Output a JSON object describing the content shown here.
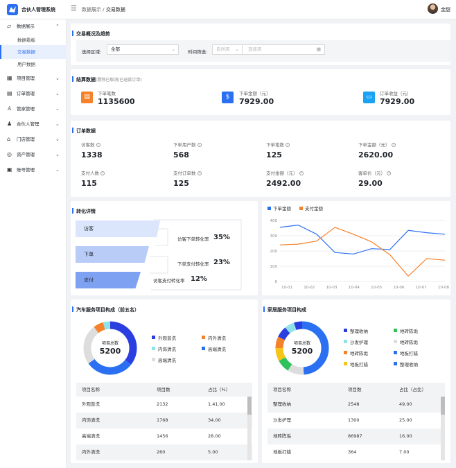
{
  "app": {
    "title": "合伙人管理系统",
    "user": "金甜"
  },
  "breadcrumb": {
    "parent": "数据展示",
    "sep": "/",
    "current": "交易数据"
  },
  "sidebar": {
    "items": [
      {
        "label": "数据展示",
        "icon": "chart-icon",
        "arrow": "^"
      },
      {
        "label": "数据看板"
      },
      {
        "label": "交易数据"
      },
      {
        "label": "用户数据"
      },
      {
        "label": "项目管理",
        "icon": "grid-icon",
        "arrow": "v"
      },
      {
        "label": "订单管理",
        "icon": "clipboard-icon",
        "arrow": "v"
      },
      {
        "label": "管家管理",
        "icon": "person-icon",
        "arrow": "v"
      },
      {
        "label": "合伙人管理",
        "icon": "people-icon",
        "arrow": "v"
      },
      {
        "label": "门店管理",
        "icon": "store-icon",
        "arrow": "v"
      },
      {
        "label": "资产管理",
        "icon": "coin-icon",
        "arrow": "v"
      },
      {
        "label": "账号管理",
        "icon": "account-icon",
        "arrow": "v"
      }
    ]
  },
  "overview": {
    "title": "交易概况及趋势",
    "region_label": "选择区域:",
    "region_value": "全部",
    "time_label": "时间筛选:",
    "time_unit": "自然周",
    "date_placeholder": "选择周"
  },
  "settlement": {
    "title": "结算数据",
    "note": "(剔除已取消/已退款订单)",
    "stats": [
      {
        "label": "下单笔数",
        "value": "1135600",
        "color": "#f5822a"
      },
      {
        "label": "下单金额（元）",
        "value": "7929.00",
        "color": "#2b6ff2"
      },
      {
        "label": "订单收益（元）",
        "value": "7929.00",
        "color": "#1aa3f5"
      }
    ]
  },
  "orders": {
    "title": "订单数据",
    "stats": [
      {
        "label": "访客数",
        "value": "1338"
      },
      {
        "label": "下单用户数",
        "value": "568"
      },
      {
        "label": "下单笔数",
        "value": "125"
      },
      {
        "label": "下单金额（元）",
        "value": "2620.00"
      },
      {
        "label": "支付人数",
        "value": "115"
      },
      {
        "label": "支付订单数",
        "value": "125"
      },
      {
        "label": "支付金额（元）",
        "value": "2492.00"
      },
      {
        "label": "客单价（元）",
        "value": "29.00"
      }
    ]
  },
  "conversion": {
    "title": "转化详情",
    "steps": [
      "访客",
      "下单",
      "支付"
    ],
    "rates": [
      {
        "label": "访客下单转化率",
        "value": "35%"
      },
      {
        "label": "下单支付转化率",
        "value": "23%"
      },
      {
        "label": "访客支付转化率",
        "value": "12%"
      }
    ]
  },
  "chart_data": {
    "type": "line",
    "x": [
      "10-01",
      "10-02",
      "10-03",
      "10-04",
      "10-05",
      "10-06",
      "10-07",
      "10-08"
    ],
    "ylim": [
      0,
      400
    ],
    "yticks": [
      0,
      100,
      200,
      300,
      400
    ],
    "legend_position": "top-left",
    "series": [
      {
        "name": "下单金额",
        "color": "#2b6ff2",
        "values": [
          355,
          370,
          310,
          190,
          180,
          215,
          210,
          335,
          320,
          310
        ]
      },
      {
        "name": "支付金额",
        "color": "#f5822a",
        "values": [
          240,
          245,
          265,
          355,
          310,
          260,
          175,
          35,
          150,
          140
        ]
      }
    ],
    "x_positions_note": ""
  },
  "car_service": {
    "title": "汽车服务项目构成（前五名）",
    "center_label": "项目总数",
    "center_value": "5200",
    "legend": [
      {
        "name": "外观普洗",
        "color": "#2b3fe0"
      },
      {
        "name": "内外清洗",
        "color": "#f5822a"
      },
      {
        "name": "内饰清洗",
        "color": "#8fe3e8"
      },
      {
        "name": "高端清洗",
        "color": "#2b6ff2"
      },
      {
        "name": "高端清洗",
        "color": "#dddddd"
      }
    ],
    "slices": [
      41,
      34,
      28,
      7,
      5
    ],
    "slice_colors": [
      "#2b3fe0",
      "#2b6ff2",
      "#dddddd",
      "#f5822a",
      "#8fe3e8"
    ],
    "headers": [
      "项目名称",
      "项目数",
      "占比（%）"
    ],
    "rows": [
      [
        "外观普洗",
        "2132",
        "1.41.00"
      ],
      [
        "内饰清洗",
        "1768",
        "34.00"
      ],
      [
        "高端清洗",
        "1456",
        "28.00"
      ],
      [
        "内外清洗",
        "260",
        "5.00"
      ]
    ]
  },
  "home_service": {
    "title": "家居服务项目构成",
    "center_label": "项目总数",
    "center_value": "5200",
    "legend": [
      {
        "name": "整理收纳",
        "color": "#2b3fe0"
      },
      {
        "name": "地砖陈垢",
        "color": "#2fc25b"
      },
      {
        "name": "沙发护理",
        "color": "#8fe3e8"
      },
      {
        "name": "地砖陈垢",
        "color": "#dddddd"
      },
      {
        "name": "地砖陈垢",
        "color": "#f5822a"
      },
      {
        "name": "地板打蜡",
        "color": "#2b6ff2"
      },
      {
        "name": "地板打蜡",
        "color": "#f5c518"
      },
      {
        "name": "整理收纳",
        "color": "#2b6ff2"
      }
    ],
    "slices": [
      49,
      10,
      8,
      8,
      7,
      7,
      6,
      5
    ],
    "slice_colors": [
      "#2b6ff2",
      "#dddddd",
      "#2fc25b",
      "#f5c518",
      "#f5822a",
      "#2b3fe0",
      "#8fe3e8",
      "#2b3fe0"
    ],
    "headers": [
      "项目名称",
      "项目数",
      "占比（占比）"
    ],
    "rows": [
      [
        "整理收纳",
        "2548",
        "49.00"
      ],
      [
        "沙发护理",
        "1300",
        "25.00"
      ],
      [
        "地砖陈垢",
        "86987",
        "16.00"
      ],
      [
        "地板打蜡",
        "364",
        "7.00"
      ]
    ]
  }
}
